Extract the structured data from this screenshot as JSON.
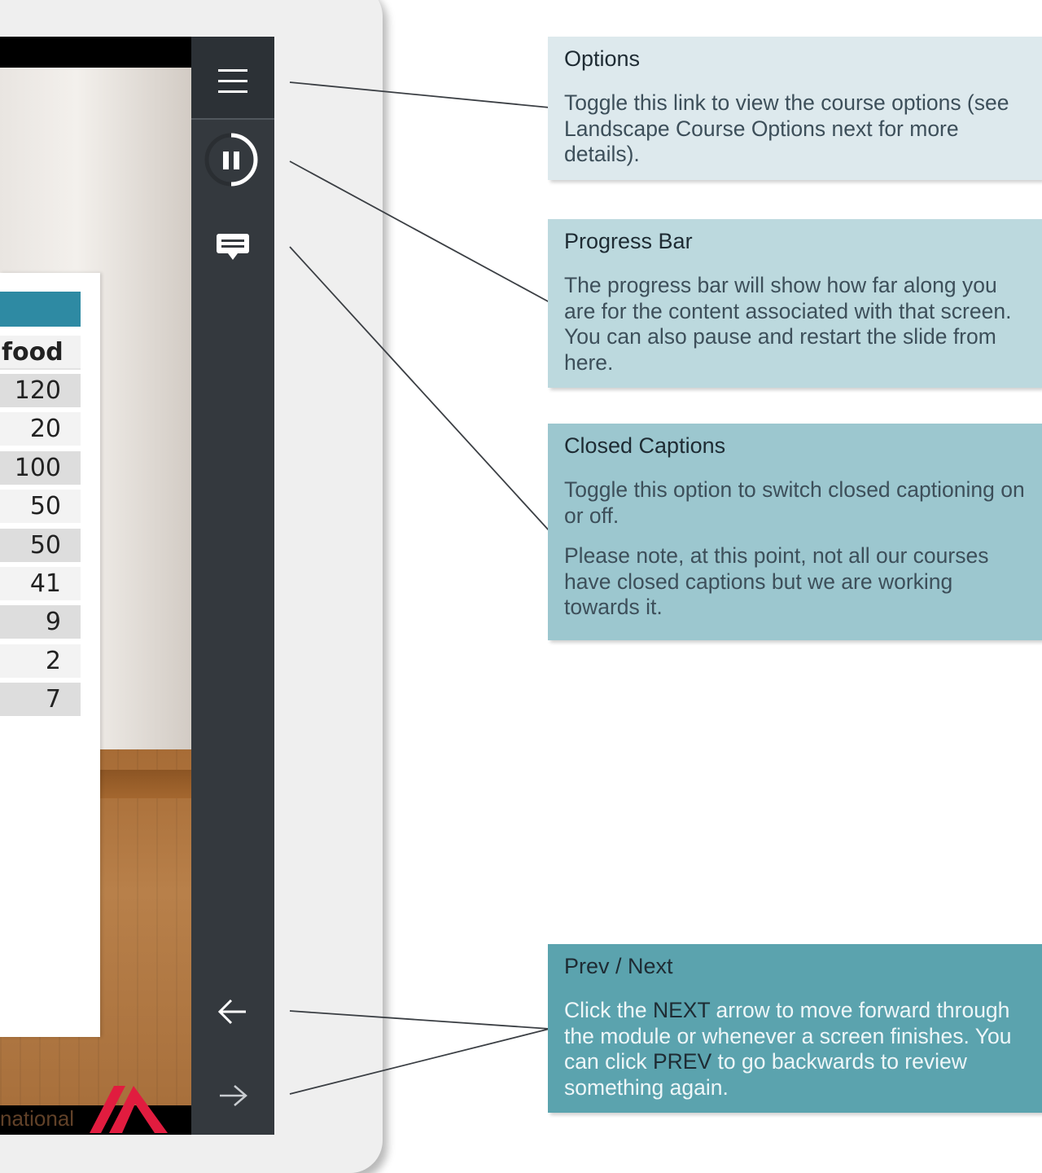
{
  "table": {
    "header": "food",
    "values": [
      "120",
      "20",
      "100",
      "50",
      "50",
      "41",
      "9",
      "2",
      "7"
    ]
  },
  "logo": {
    "text": "national"
  },
  "sidebar": {
    "icons": [
      "menu-icon",
      "pause-icon",
      "captions-icon",
      "arrow-left-icon",
      "arrow-right-icon"
    ]
  },
  "callouts": {
    "options": {
      "title": "Options",
      "text": "Toggle this link to view the course options (see Landscape Course Options next for more details)."
    },
    "progress": {
      "title": "Progress Bar",
      "text": "The progress bar will show how far along you are for the content associated with that screen.  You can also pause and restart the slide from here."
    },
    "captions": {
      "title": "Closed Captions",
      "text1": "Toggle this option to switch closed captioning on or off.",
      "text2": "Please note, at this point, not all our courses have closed captions but we are working towards it."
    },
    "prevnext": {
      "title": "Prev / Next",
      "t1": "Click the ",
      "next_word": "NEXT",
      "t2": " arrow to move forward through the module or whenever a screen finishes.  You can click ",
      "prev_word": "PREV",
      "t3": " to go backwards to review something again."
    }
  },
  "colors": {
    "sidebar": "#34393e",
    "callout_options": "#dde9ed",
    "callout_progress": "#bcd9de",
    "callout_captions": "#9cc7cf",
    "callout_prevnext": "#5ba3ae",
    "table_bar": "#2e8aa3",
    "logo_red": "#e11c3f"
  }
}
